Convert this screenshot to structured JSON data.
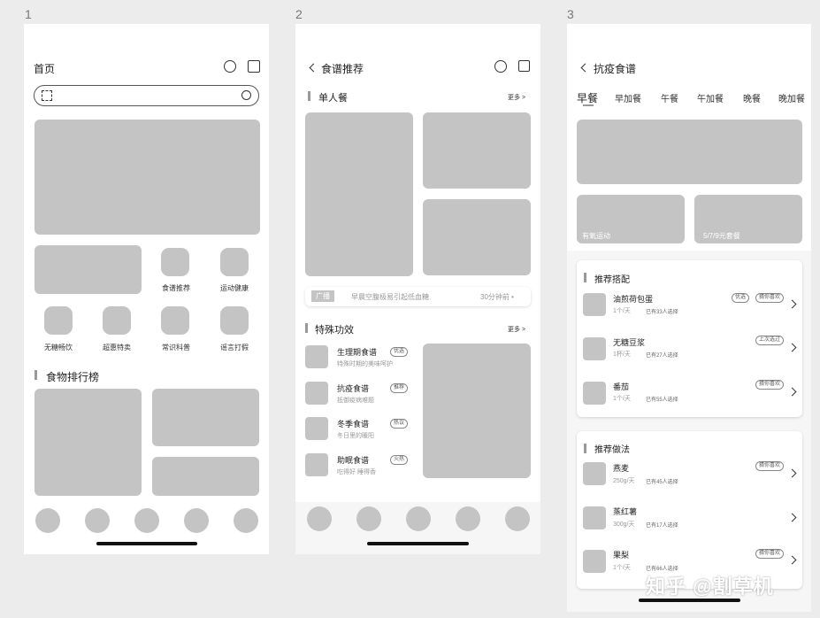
{
  "screen_numbers": [
    "1",
    "2",
    "3"
  ],
  "screen1": {
    "title": "首页",
    "icons": [
      "message-icon",
      "calendar-check-icon"
    ],
    "search": {
      "placeholder": ""
    },
    "grid_items": [
      "食谱推荐",
      "运动健康",
      "无糖畅饮",
      "超惠特卖",
      "常识科普",
      "谣言打假"
    ],
    "section_title": "食物排行榜"
  },
  "screen2": {
    "title": "食谱推荐",
    "section1": {
      "title": "单人餐",
      "more": "更多 >"
    },
    "ad": {
      "tag": "广播",
      "text": "早晨空腹极易引起低血糖",
      "time": "30分钟前 •"
    },
    "section2": {
      "title": "特殊功效",
      "more": "更多 >"
    },
    "list": [
      {
        "title": "生理期食谱",
        "sub": "特殊时期的美味呵护",
        "badge": "优选"
      },
      {
        "title": "抗疫食谱",
        "sub": "抵御疫病难题",
        "badge": "推荐"
      },
      {
        "title": "冬季食谱",
        "sub": "冬日里的暖阳",
        "badge": "热议"
      },
      {
        "title": "助眠食谱",
        "sub": "吃得好 睡得香",
        "badge": "火热"
      }
    ]
  },
  "screen3": {
    "title": "抗疫食谱",
    "tabs": [
      "早餐",
      "早加餐",
      "午餐",
      "午加餐",
      "晚餐",
      "晚加餐"
    ],
    "banners": [
      "有氧运动",
      "5/7/9元套餐"
    ],
    "section1": {
      "title": "推荐搭配",
      "items": [
        {
          "name": "油煎荷包蛋",
          "qty": "1个/天",
          "count": "已有33人选择",
          "badges": [
            "优选",
            "猜你喜欢"
          ]
        },
        {
          "name": "无糖豆浆",
          "qty": "1杯/天",
          "count": "已有27人选择",
          "badges": [
            "上次选过"
          ]
        },
        {
          "name": "番茄",
          "qty": "1个/天",
          "count": "已有55人选择",
          "badges": [
            "猜你喜欢"
          ]
        }
      ]
    },
    "section2": {
      "title": "推荐做法",
      "items": [
        {
          "name": "燕麦",
          "qty": "250g/天",
          "count": "已有45人选择",
          "badges": [
            "猜你喜欢"
          ]
        },
        {
          "name": "蒸红薯",
          "qty": "300g/天",
          "count": "已有17人选择",
          "badges": []
        },
        {
          "name": "果梨",
          "qty": "1个/天",
          "count": "已有66人选择",
          "badges": [
            "猜你喜欢"
          ]
        }
      ]
    }
  },
  "watermark": "知乎 @割草机",
  "colors": {
    "placeholder": "#c4c4c4",
    "background": "#ececec"
  }
}
